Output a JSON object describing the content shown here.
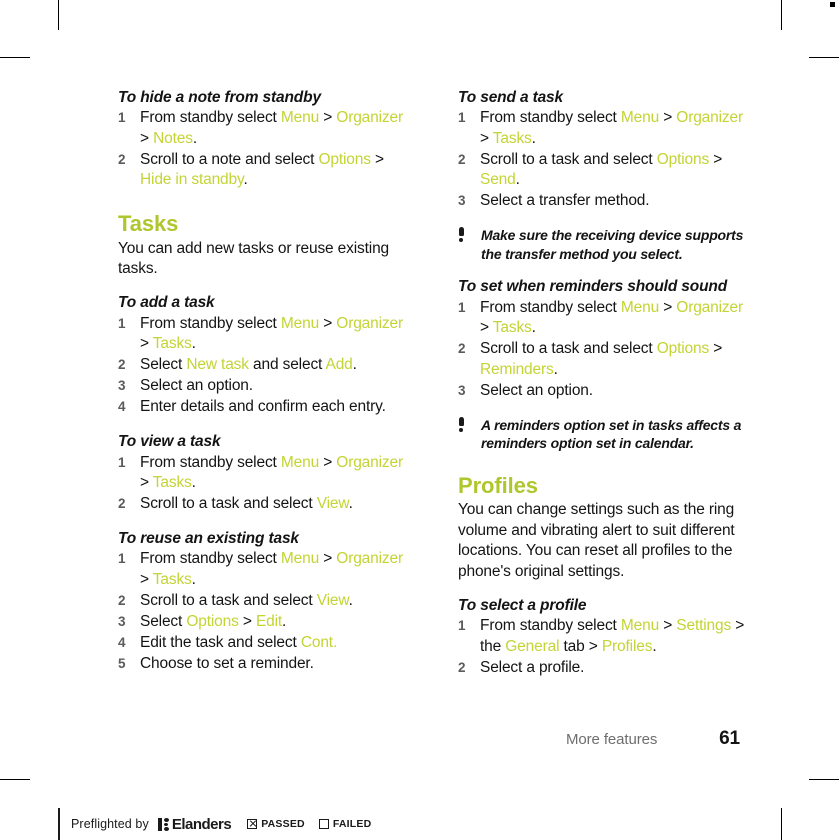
{
  "page": {
    "footer_section": "More features",
    "page_number": "61"
  },
  "left_column": {
    "blocks": [
      {
        "type": "heading3",
        "text": "To hide a note from standby"
      },
      {
        "type": "steps",
        "items": [
          {
            "num": "1",
            "parts": [
              {
                "t": "From standby select ",
                "s": "plain"
              },
              {
                "t": "Menu",
                "s": "gui"
              },
              {
                "t": " > ",
                "s": "plain"
              },
              {
                "t": "Organizer",
                "s": "gui"
              },
              {
                "t": " > ",
                "s": "plain"
              },
              {
                "t": "Notes",
                "s": "gui"
              },
              {
                "t": ".",
                "s": "plain"
              }
            ]
          },
          {
            "num": "2",
            "parts": [
              {
                "t": "Scroll to a note and select ",
                "s": "plain"
              },
              {
                "t": "Options",
                "s": "gui"
              },
              {
                "t": " > ",
                "s": "plain"
              },
              {
                "t": "Hide in standby",
                "s": "gui"
              },
              {
                "t": ".",
                "s": "plain"
              }
            ]
          }
        ]
      },
      {
        "type": "heading2",
        "text": "Tasks"
      },
      {
        "type": "paragraph",
        "text": "You can add new tasks or reuse existing tasks."
      },
      {
        "type": "heading3",
        "text": "To add a task"
      },
      {
        "type": "steps",
        "items": [
          {
            "num": "1",
            "parts": [
              {
                "t": "From standby select ",
                "s": "plain"
              },
              {
                "t": "Menu",
                "s": "gui"
              },
              {
                "t": " > ",
                "s": "plain"
              },
              {
                "t": "Organizer",
                "s": "gui"
              },
              {
                "t": " > ",
                "s": "plain"
              },
              {
                "t": "Tasks",
                "s": "gui"
              },
              {
                "t": ".",
                "s": "plain"
              }
            ]
          },
          {
            "num": "2",
            "parts": [
              {
                "t": "Select ",
                "s": "plain"
              },
              {
                "t": "New task",
                "s": "gui"
              },
              {
                "t": " and select ",
                "s": "plain"
              },
              {
                "t": "Add",
                "s": "gui"
              },
              {
                "t": ".",
                "s": "plain"
              }
            ]
          },
          {
            "num": "3",
            "parts": [
              {
                "t": "Select an option.",
                "s": "plain"
              }
            ]
          },
          {
            "num": "4",
            "parts": [
              {
                "t": "Enter details and confirm each entry.",
                "s": "plain"
              }
            ]
          }
        ]
      },
      {
        "type": "heading3",
        "text": "To view a task"
      },
      {
        "type": "steps",
        "items": [
          {
            "num": "1",
            "parts": [
              {
                "t": "From standby select ",
                "s": "plain"
              },
              {
                "t": "Menu",
                "s": "gui"
              },
              {
                "t": " > ",
                "s": "plain"
              },
              {
                "t": "Organizer",
                "s": "gui"
              },
              {
                "t": " > ",
                "s": "plain"
              },
              {
                "t": "Tasks",
                "s": "gui"
              },
              {
                "t": ".",
                "s": "plain"
              }
            ]
          },
          {
            "num": "2",
            "parts": [
              {
                "t": "Scroll to a task and select ",
                "s": "plain"
              },
              {
                "t": "View",
                "s": "gui"
              },
              {
                "t": ".",
                "s": "plain"
              }
            ]
          }
        ]
      },
      {
        "type": "heading3",
        "text": "To reuse an existing task"
      },
      {
        "type": "steps",
        "items": [
          {
            "num": "1",
            "parts": [
              {
                "t": "From standby select ",
                "s": "plain"
              },
              {
                "t": "Menu",
                "s": "gui"
              },
              {
                "t": " > ",
                "s": "plain"
              },
              {
                "t": "Organizer",
                "s": "gui"
              },
              {
                "t": " > ",
                "s": "plain"
              },
              {
                "t": "Tasks",
                "s": "gui"
              },
              {
                "t": ".",
                "s": "plain"
              }
            ]
          },
          {
            "num": "2",
            "parts": [
              {
                "t": "Scroll to a task and select ",
                "s": "plain"
              },
              {
                "t": "View",
                "s": "gui"
              },
              {
                "t": ".",
                "s": "plain"
              }
            ]
          },
          {
            "num": "3",
            "parts": [
              {
                "t": "Select ",
                "s": "plain"
              },
              {
                "t": "Options",
                "s": "gui"
              },
              {
                "t": " > ",
                "s": "plain"
              },
              {
                "t": "Edit",
                "s": "gui"
              },
              {
                "t": ".",
                "s": "plain"
              }
            ]
          },
          {
            "num": "4",
            "parts": [
              {
                "t": "Edit the task and select ",
                "s": "plain"
              },
              {
                "t": "Cont.",
                "s": "gui"
              }
            ]
          },
          {
            "num": "5",
            "parts": [
              {
                "t": "Choose to set a reminder.",
                "s": "plain"
              }
            ]
          }
        ]
      }
    ]
  },
  "right_column": {
    "blocks": [
      {
        "type": "heading3",
        "text": "To send a task"
      },
      {
        "type": "steps",
        "items": [
          {
            "num": "1",
            "parts": [
              {
                "t": "From standby select ",
                "s": "plain"
              },
              {
                "t": "Menu",
                "s": "gui"
              },
              {
                "t": " > ",
                "s": "plain"
              },
              {
                "t": "Organizer",
                "s": "gui"
              },
              {
                "t": " > ",
                "s": "plain"
              },
              {
                "t": "Tasks",
                "s": "gui"
              },
              {
                "t": ".",
                "s": "plain"
              }
            ]
          },
          {
            "num": "2",
            "parts": [
              {
                "t": "Scroll to a task and select ",
                "s": "plain"
              },
              {
                "t": "Options",
                "s": "gui"
              },
              {
                "t": " > ",
                "s": "plain"
              },
              {
                "t": "Send",
                "s": "gui"
              },
              {
                "t": ".",
                "s": "plain"
              }
            ]
          },
          {
            "num": "3",
            "parts": [
              {
                "t": "Select a transfer method.",
                "s": "plain"
              }
            ]
          }
        ]
      },
      {
        "type": "tip",
        "icon": "exclamation-icon",
        "text": "Make sure the receiving device supports the transfer method you select."
      },
      {
        "type": "heading3",
        "text": "To set when reminders should sound"
      },
      {
        "type": "steps",
        "items": [
          {
            "num": "1",
            "parts": [
              {
                "t": "From standby select ",
                "s": "plain"
              },
              {
                "t": "Menu",
                "s": "gui"
              },
              {
                "t": " > ",
                "s": "plain"
              },
              {
                "t": "Organizer",
                "s": "gui"
              },
              {
                "t": " > ",
                "s": "plain"
              },
              {
                "t": "Tasks",
                "s": "gui"
              },
              {
                "t": ".",
                "s": "plain"
              }
            ]
          },
          {
            "num": "2",
            "parts": [
              {
                "t": "Scroll to a task and select ",
                "s": "plain"
              },
              {
                "t": "Options",
                "s": "gui"
              },
              {
                "t": " > ",
                "s": "plain"
              },
              {
                "t": "Reminders",
                "s": "gui"
              },
              {
                "t": ".",
                "s": "plain"
              }
            ]
          },
          {
            "num": "3",
            "parts": [
              {
                "t": "Select an option.",
                "s": "plain"
              }
            ]
          }
        ]
      },
      {
        "type": "tip",
        "icon": "exclamation-icon",
        "text": "A reminders option set in tasks affects a reminders option set in calendar."
      },
      {
        "type": "heading2",
        "text": "Profiles"
      },
      {
        "type": "paragraph",
        "text": "You can change settings such as the ring volume and vibrating alert to suit different locations. You can reset all profiles to the phone's original settings."
      },
      {
        "type": "heading3",
        "text": "To select a profile"
      },
      {
        "type": "steps",
        "items": [
          {
            "num": "1",
            "parts": [
              {
                "t": "From standby select ",
                "s": "plain"
              },
              {
                "t": "Menu",
                "s": "gui"
              },
              {
                "t": " > ",
                "s": "plain"
              },
              {
                "t": "Settings",
                "s": "gui"
              },
              {
                "t": " > the ",
                "s": "plain"
              },
              {
                "t": "General",
                "s": "gui"
              },
              {
                "t": " tab > ",
                "s": "plain"
              },
              {
                "t": "Profiles",
                "s": "gui"
              },
              {
                "t": ".",
                "s": "plain"
              }
            ]
          },
          {
            "num": "2",
            "parts": [
              {
                "t": "Select a profile.",
                "s": "plain"
              }
            ]
          }
        ]
      }
    ]
  },
  "preflight": {
    "prefix": "Preflighted by",
    "brand": "Elanders",
    "passed_label": "PASSED",
    "failed_label": "FAILED",
    "passed_checked": true,
    "failed_checked": false
  },
  "colors": {
    "gui_green": "#c3d434",
    "heading_green": "#b0c62d",
    "text_black": "#141414",
    "footer_gray": "#6e6e6e"
  }
}
